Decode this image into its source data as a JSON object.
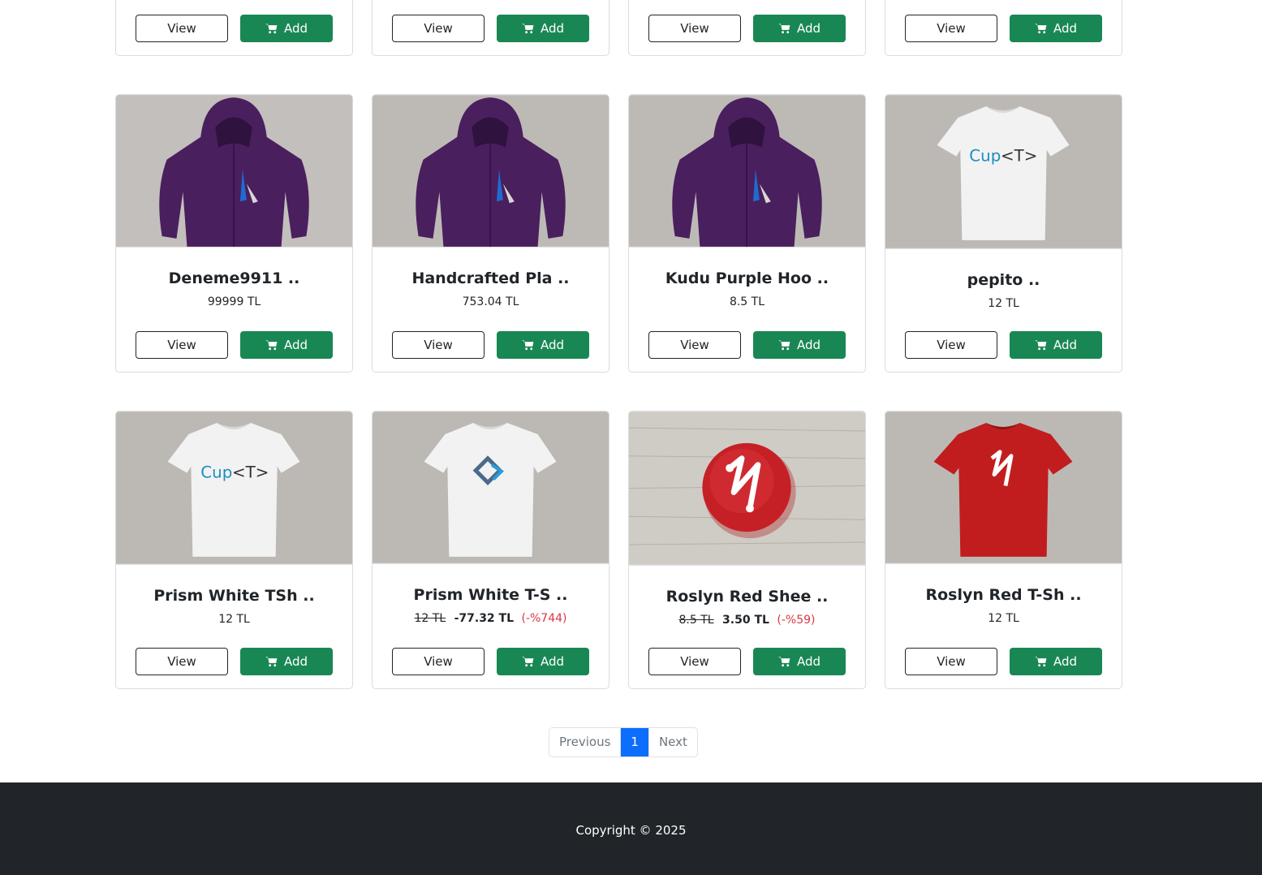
{
  "top_row": [
    {
      "view_label": "View",
      "add_label": "Add"
    },
    {
      "view_label": "View",
      "add_label": "Add"
    },
    {
      "view_label": "View",
      "add_label": "Add"
    },
    {
      "view_label": "View",
      "add_label": "Add"
    }
  ],
  "products": [
    {
      "name": "Deneme9911 ..",
      "price": "99999 TL",
      "image": "purple-hoodie-image",
      "view_label": "View",
      "add_label": "Add"
    },
    {
      "name": "Handcrafted Pla ..",
      "price": "753.04 TL",
      "image": "purple-hoodie-image",
      "view_label": "View",
      "add_label": "Add"
    },
    {
      "name": "Kudu Purple Hoo ..",
      "price": "8.5 TL",
      "image": "purple-hoodie-image",
      "view_label": "View",
      "add_label": "Add"
    },
    {
      "name": "pepito ..",
      "price": "12 TL",
      "image": "cup-t-white-tshirt-image",
      "view_label": "View",
      "add_label": "Add"
    },
    {
      "name": "Prism White TSh ..",
      "price": "12 TL",
      "image": "cup-t-white-tshirt-image",
      "view_label": "View",
      "add_label": "Add"
    },
    {
      "name": "Prism White T-S ..",
      "old_price": "12 TL",
      "new_price": "-77.32 TL",
      "discount": "(-%744)",
      "image": "prism-white-tshirt-image",
      "view_label": "View",
      "add_label": "Add"
    },
    {
      "name": "Roslyn Red Shee ..",
      "old_price": "8.5 TL",
      "new_price": "3.50 TL",
      "discount": "(-%59)",
      "image": "roslyn-red-button-image",
      "view_label": "View",
      "add_label": "Add"
    },
    {
      "name": "Roslyn Red T-Sh ..",
      "price": "12 TL",
      "image": "roslyn-red-tshirt-image",
      "view_label": "View",
      "add_label": "Add"
    }
  ],
  "pagination": {
    "previous": "Previous",
    "current": "1",
    "next": "Next"
  },
  "footer": {
    "copyright": "Copyright © 2025"
  },
  "colors": {
    "add_button": "#198754",
    "pagination_active": "#0d6efd",
    "discount": "#dc3545",
    "footer_bg": "#212529"
  }
}
